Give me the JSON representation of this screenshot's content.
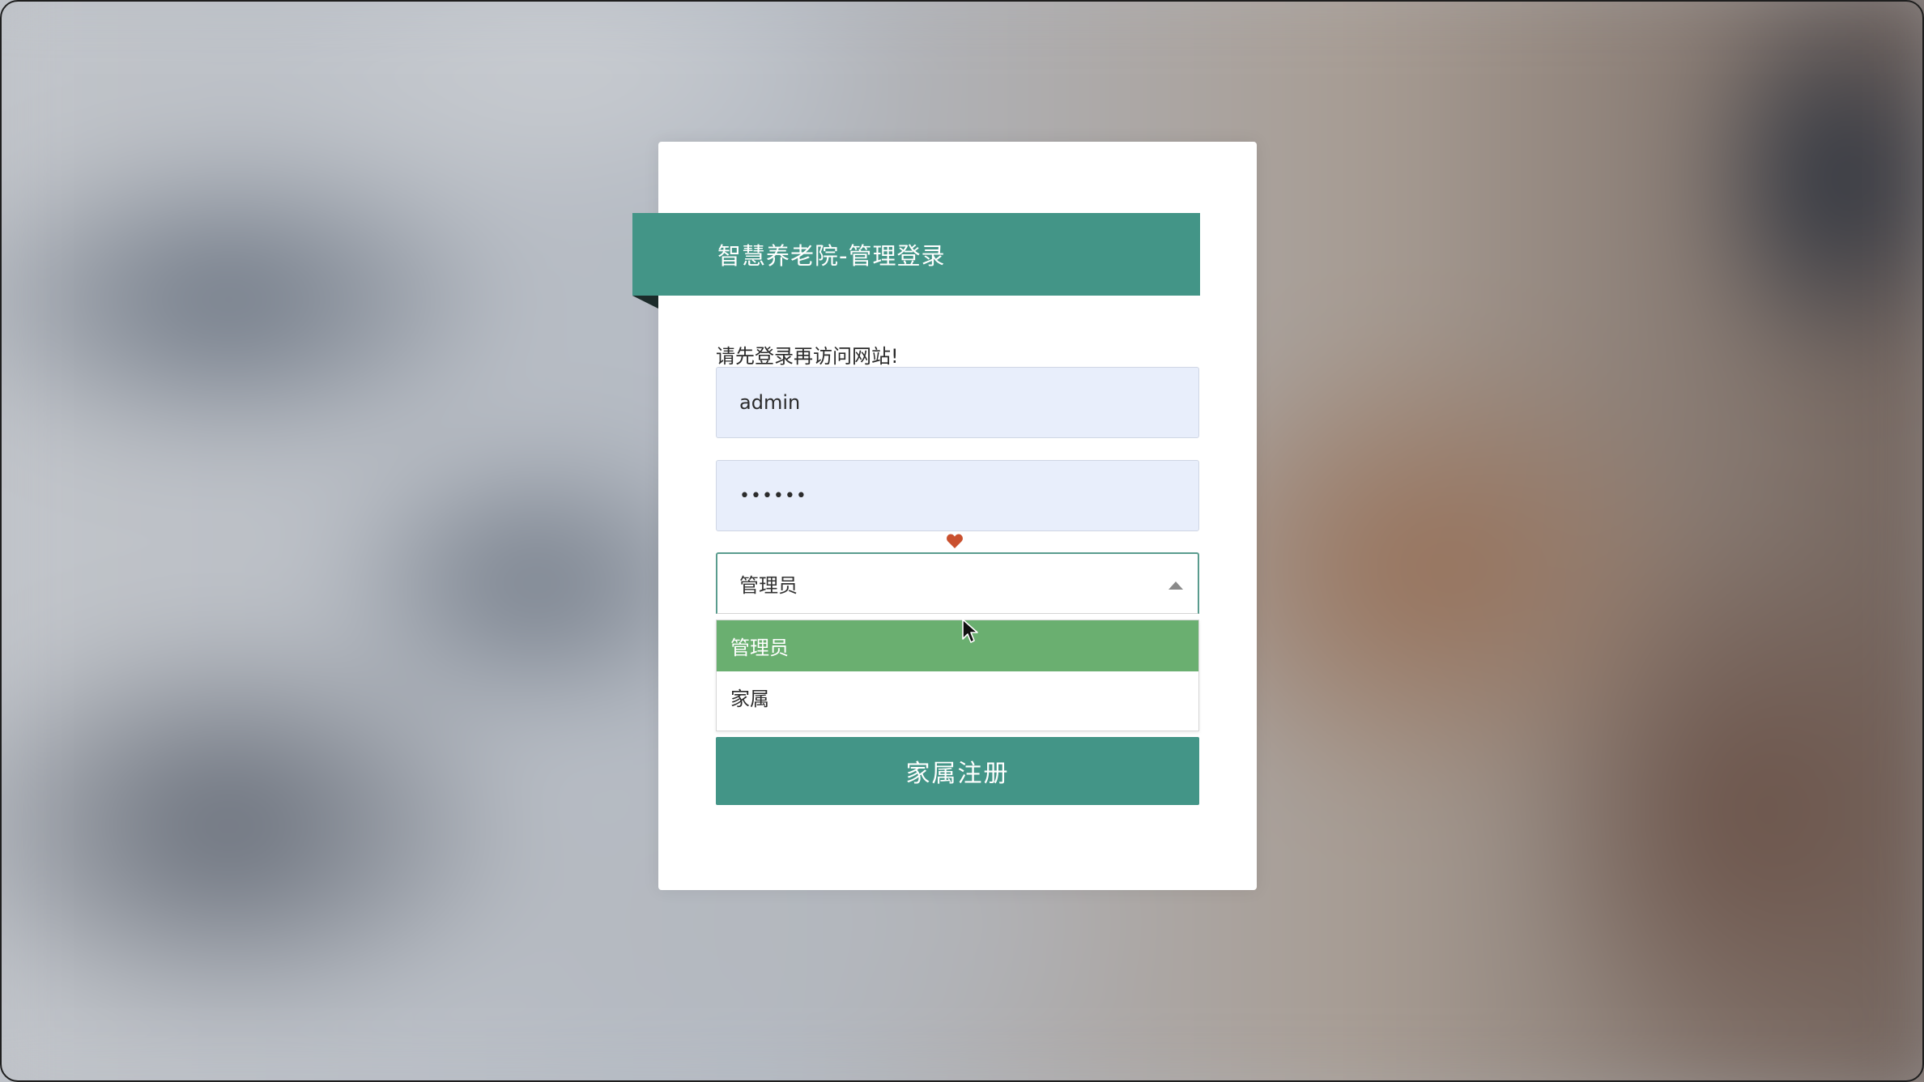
{
  "login": {
    "title": "智慧养老院-管理登录",
    "notice": "请先登录再访问网站!",
    "username_value": "admin",
    "password_value": "••••••",
    "role_select": {
      "selected": "管理员",
      "options": [
        "管理员",
        "家属"
      ]
    },
    "register_label": "家属注册"
  },
  "icons": {
    "heart": "heart-icon",
    "caret": "caret-up-icon",
    "cursor": "mouse-pointer-icon"
  },
  "colors": {
    "primary": "#439587",
    "option_highlight": "#6aaf70",
    "input_bg": "#e8eefb",
    "heart": "#c9502e"
  }
}
